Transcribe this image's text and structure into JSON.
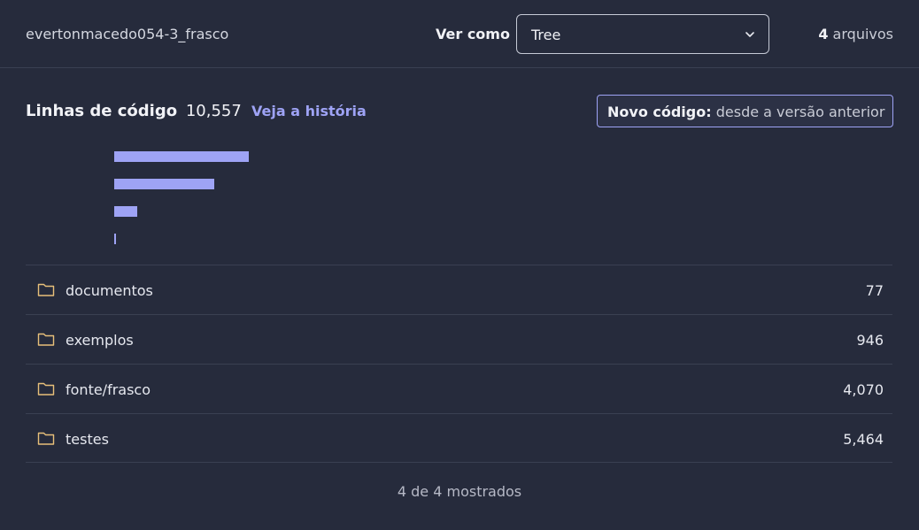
{
  "header": {
    "project_name": "evertonmacedo054-3_frasco",
    "view_label": "Ver como",
    "view_select_value": "Tree",
    "file_count_number": "4",
    "file_count_label": " arquivos"
  },
  "summary": {
    "title": "Linhas de código",
    "value": "10,557",
    "history_link": "Veja a história",
    "new_code_label": "Novo código:",
    "new_code_value": " desde a versão anterior"
  },
  "chart_data": {
    "type": "bar",
    "orientation": "horizontal",
    "categories": [
      "testes",
      "fonte/frasco",
      "exemplos",
      "documentos"
    ],
    "values": [
      5464,
      4070,
      946,
      77
    ],
    "color": "#9ea3f5"
  },
  "rows": [
    {
      "name": "documentos",
      "count": "77"
    },
    {
      "name": "exemplos",
      "count": "946"
    },
    {
      "name": "fonte/frasco",
      "count": "4,070"
    },
    {
      "name": "testes",
      "count": "5,464"
    }
  ],
  "footer": {
    "shown": "4 de 4 mostrados"
  },
  "icons": {
    "row_icon": "folder-icon",
    "select_icon": "chevron-down-icon"
  },
  "colors": {
    "background": "#262b3c",
    "accent": "#9ea3f5",
    "divider": "#3a4052"
  }
}
